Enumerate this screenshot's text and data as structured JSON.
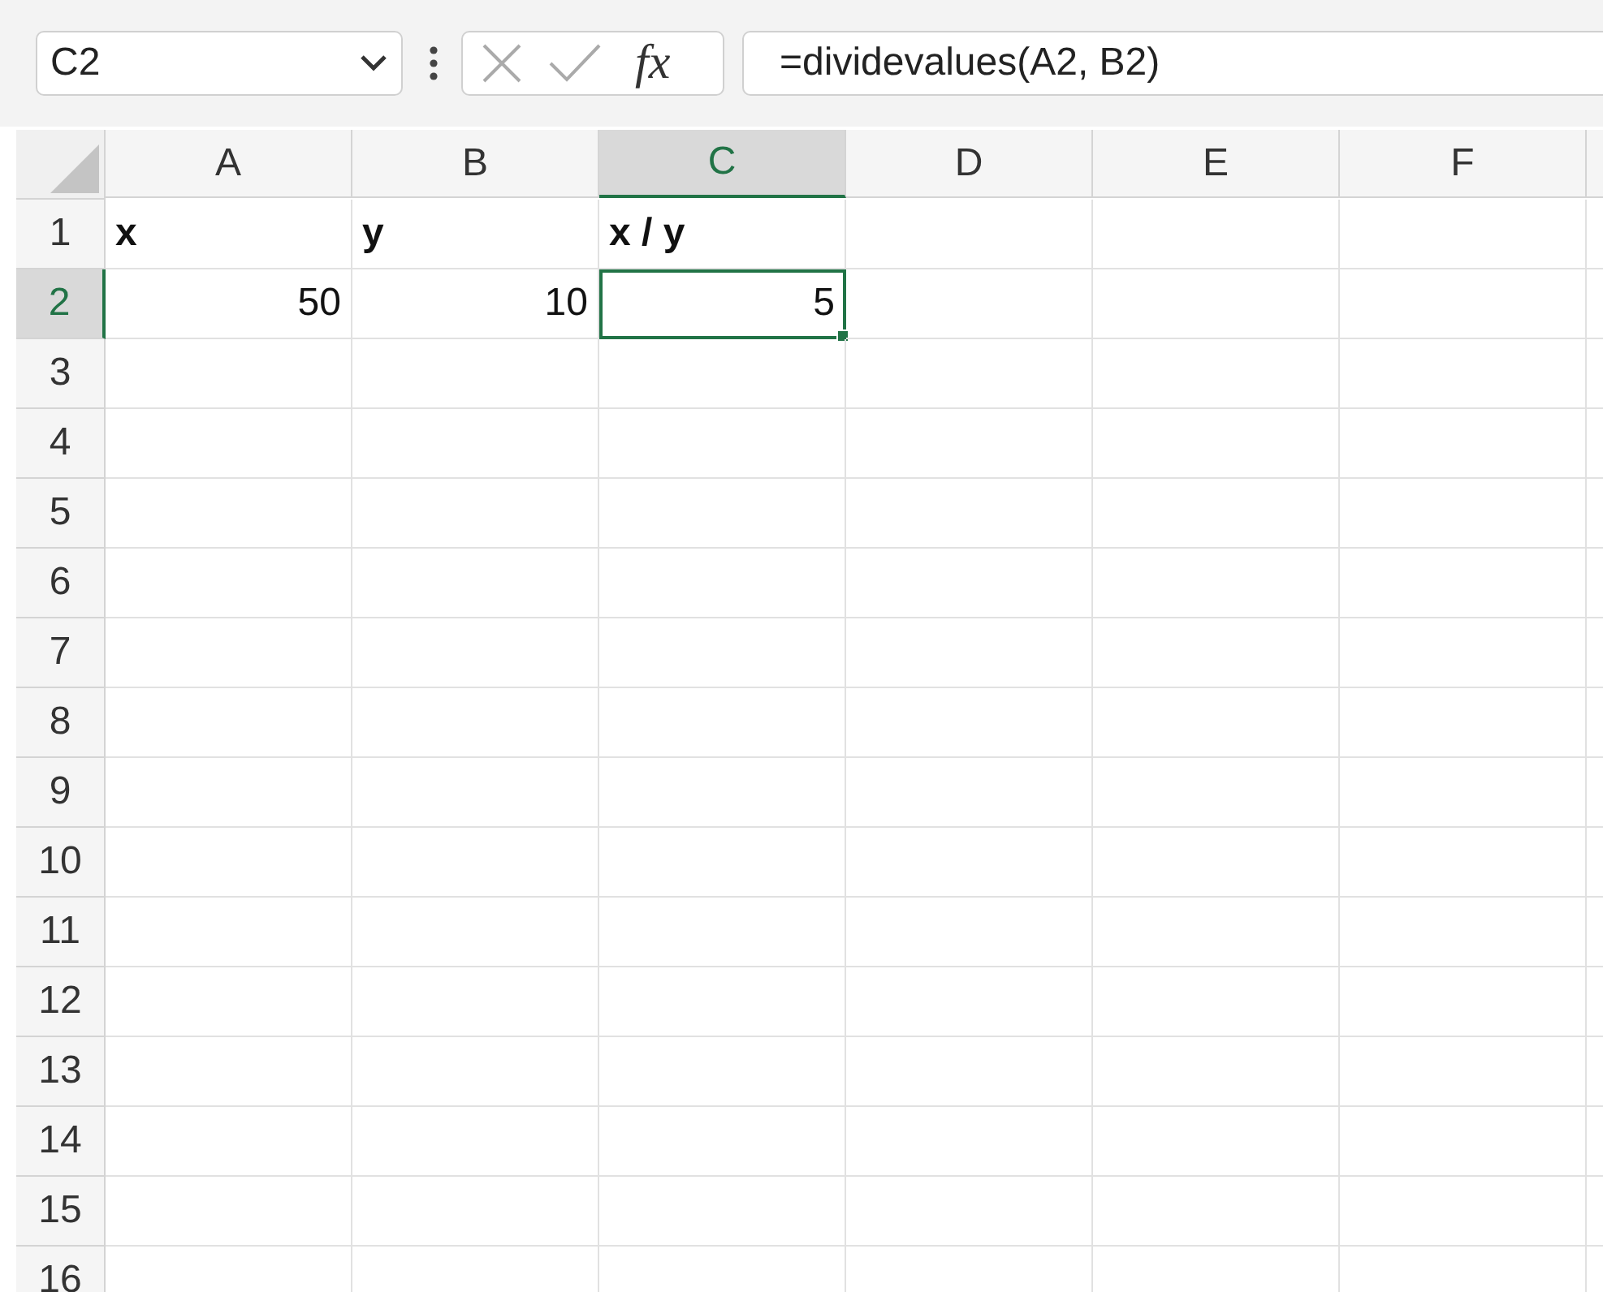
{
  "name_box": {
    "value": "C2"
  },
  "formula_bar": {
    "function_label": "fx",
    "formula": "=dividevalues(A2, B2)"
  },
  "columns": [
    {
      "label": "A",
      "selected": false
    },
    {
      "label": "B",
      "selected": false
    },
    {
      "label": "C",
      "selected": true
    },
    {
      "label": "D",
      "selected": false
    },
    {
      "label": "E",
      "selected": false
    },
    {
      "label": "F",
      "selected": false
    }
  ],
  "rows": [
    {
      "label": "1",
      "selected": false,
      "cells": [
        {
          "value": "x",
          "kind": "text",
          "bold": true,
          "selected": false
        },
        {
          "value": "y",
          "kind": "text",
          "bold": true,
          "selected": false
        },
        {
          "value": "x / y",
          "kind": "text",
          "bold": true,
          "selected": false
        }
      ]
    },
    {
      "label": "2",
      "selected": true,
      "cells": [
        {
          "value": "50",
          "kind": "number",
          "bold": false,
          "selected": false
        },
        {
          "value": "10",
          "kind": "number",
          "bold": false,
          "selected": false
        },
        {
          "value": "5",
          "kind": "number",
          "bold": false,
          "selected": true
        }
      ]
    },
    {
      "label": "3",
      "selected": false
    },
    {
      "label": "4",
      "selected": false
    },
    {
      "label": "5",
      "selected": false
    },
    {
      "label": "6",
      "selected": false
    },
    {
      "label": "7",
      "selected": false
    },
    {
      "label": "8",
      "selected": false
    },
    {
      "label": "9",
      "selected": false
    },
    {
      "label": "10",
      "selected": false
    },
    {
      "label": "11",
      "selected": false
    },
    {
      "label": "12",
      "selected": false
    },
    {
      "label": "13",
      "selected": false
    },
    {
      "label": "14",
      "selected": false
    },
    {
      "label": "15",
      "selected": false
    },
    {
      "label": "16",
      "selected": false
    }
  ]
}
